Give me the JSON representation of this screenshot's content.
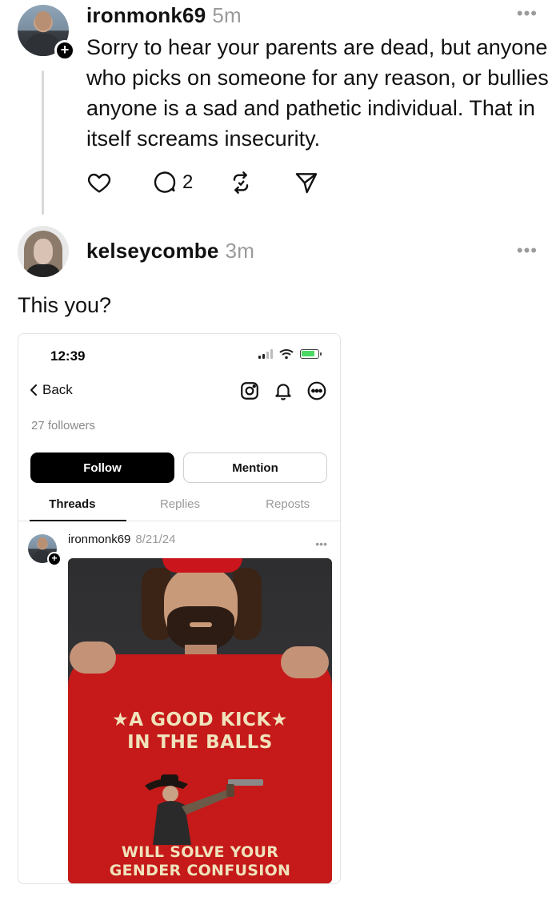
{
  "post1": {
    "username": "ironmonk69",
    "time": "5m",
    "more": "•••",
    "text": "Sorry to hear your parents are dead, but anyone who picks on someone for any reason, or bullies anyone is a sad and pathetic individual. That in itself screams insecurity.",
    "actions": {
      "like_icon": "heart-icon",
      "reply_icon": "comment-icon",
      "reply_count": "2",
      "repost_icon": "repost-icon",
      "share_icon": "send-icon"
    }
  },
  "post2": {
    "username": "kelseycombe",
    "time": "3m",
    "more": "•••",
    "text": "This you?"
  },
  "embedded": {
    "status_time": "12:39",
    "back_label": "Back",
    "followers": "27 followers",
    "follow_label": "Follow",
    "mention_label": "Mention",
    "tabs": [
      "Threads",
      "Replies",
      "Reposts"
    ],
    "active_tab": "Threads",
    "post": {
      "username": "ironmonk69",
      "date": "8/21/24",
      "more": "•••",
      "shirt_line1": "★A GOOD KICK★",
      "shirt_line2": "IN THE BALLS",
      "shirt_line3": "WILL SOLVE YOUR",
      "shirt_line4": "GENDER CONFUSION"
    }
  },
  "colors": {
    "text": "#111111",
    "muted": "#9a9a9a",
    "shirt_red": "#c51a19",
    "shirt_print": "#f0e2bc",
    "battery_green": "#4cd964"
  }
}
